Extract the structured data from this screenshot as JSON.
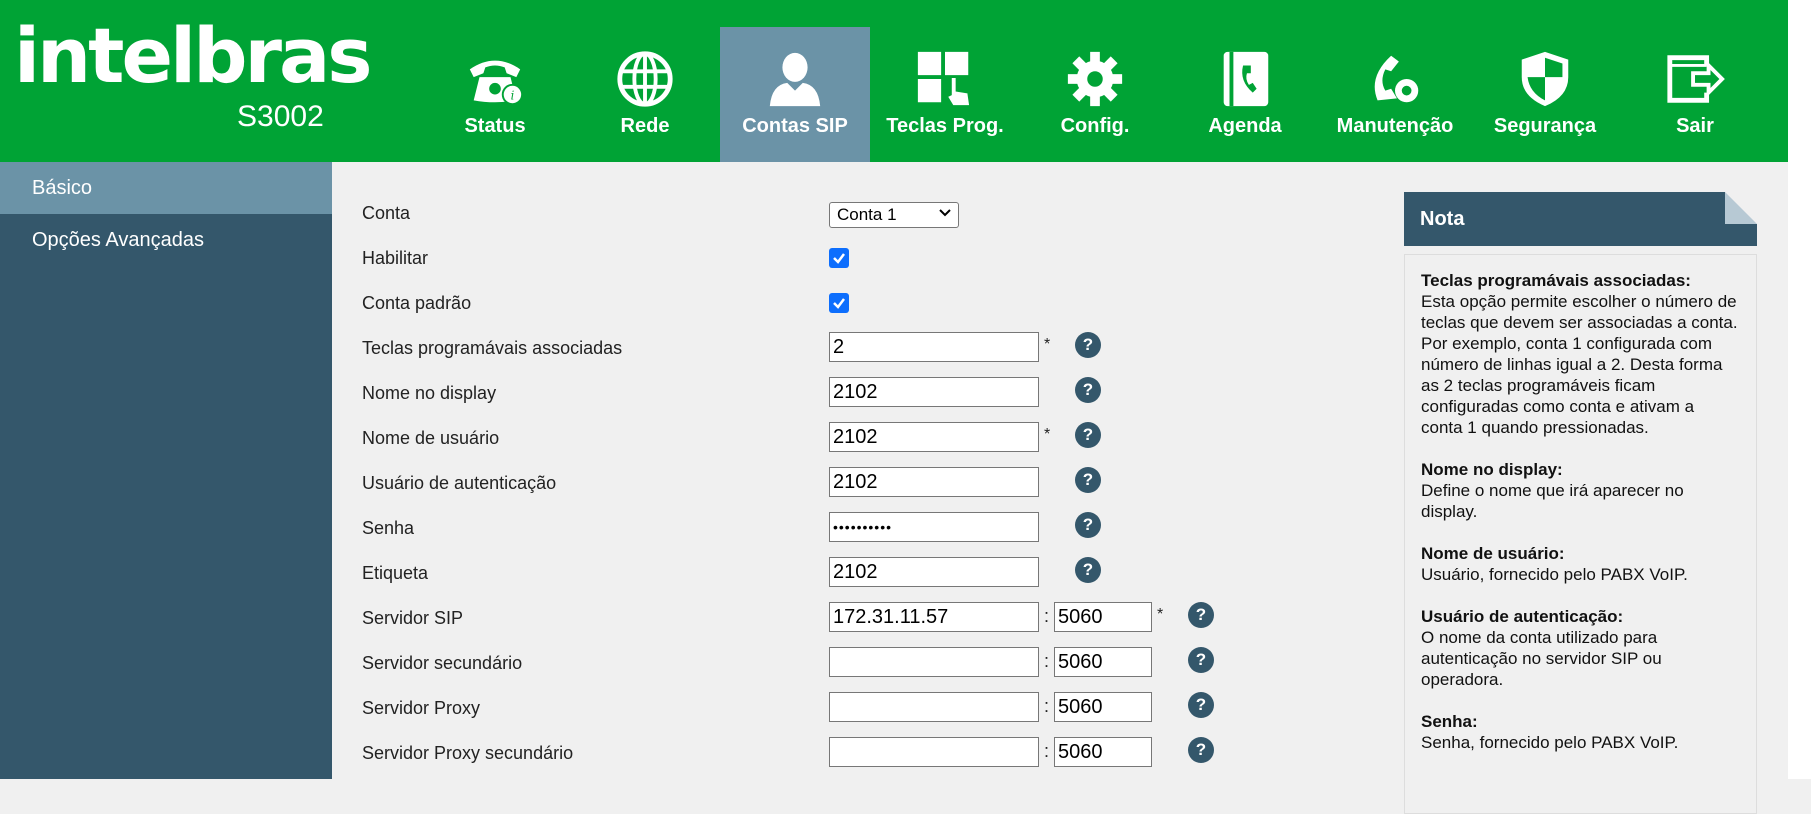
{
  "brand": {
    "logo": "intelbras",
    "model": "S3002"
  },
  "nav": [
    {
      "label": "Status",
      "icon": "phone-icon",
      "active": false
    },
    {
      "label": "Rede",
      "icon": "globe-icon",
      "active": false
    },
    {
      "label": "Contas SIP",
      "icon": "user-icon",
      "active": true
    },
    {
      "label": "Teclas Prog.",
      "icon": "keypad-icon",
      "active": false
    },
    {
      "label": "Config.",
      "icon": "gear-icon",
      "active": false
    },
    {
      "label": "Agenda",
      "icon": "phonebook-icon",
      "active": false
    },
    {
      "label": "Manutenção",
      "icon": "maintenance-icon",
      "active": false
    },
    {
      "label": "Segurança",
      "icon": "shield-icon",
      "active": false
    },
    {
      "label": "Sair",
      "icon": "logout-icon",
      "active": false
    }
  ],
  "sidebar": [
    {
      "label": "Básico",
      "active": true
    },
    {
      "label": "Opções Avançadas",
      "active": false
    }
  ],
  "form": {
    "conta": {
      "label": "Conta",
      "value": "Conta 1"
    },
    "habilitar": {
      "label": "Habilitar",
      "checked": true
    },
    "conta_padrao": {
      "label": "Conta padrão",
      "checked": true
    },
    "teclas": {
      "label": "Teclas programávais associadas",
      "value": "2",
      "required": "*"
    },
    "nome_display": {
      "label": "Nome no display",
      "value": "2102"
    },
    "nome_usuario": {
      "label": "Nome de usuário",
      "value": "2102",
      "required": "*"
    },
    "usuario_auth": {
      "label": "Usuário de autenticação",
      "value": "2102"
    },
    "senha": {
      "label": "Senha",
      "value": "••••••••••"
    },
    "etiqueta": {
      "label": "Etiqueta",
      "value": "2102"
    },
    "servidor_sip": {
      "label": "Servidor SIP",
      "value": "172.31.11.57",
      "port": "5060",
      "required": "*"
    },
    "servidor_secundario": {
      "label": "Servidor secundário",
      "value": "",
      "port": "5060"
    },
    "servidor_proxy": {
      "label": "Servidor Proxy",
      "value": "",
      "port": "5060"
    },
    "servidor_proxy_sec": {
      "label": "Servidor Proxy secundário",
      "value": "",
      "port": "5060"
    },
    "colon": ":",
    "help_glyph": "?"
  },
  "note": {
    "title": "Nota",
    "items": [
      {
        "title": "Teclas programávais associadas:",
        "text": "Esta opção permite escolher o número de teclas que devem ser associadas a conta. Por exemplo, conta 1 configurada com número de linhas igual a 2. Desta forma as 2 teclas programáveis ficam configuradas como conta e ativam a conta 1 quando pressionadas."
      },
      {
        "title": "Nome no display:",
        "text": "Define o nome que irá aparecer no display."
      },
      {
        "title": "Nome de usuário:",
        "text": "Usuário, fornecido pelo PABX VoIP."
      },
      {
        "title": "Usuário de autenticação:",
        "text": "O nome da conta utilizado para autenticação no servidor SIP ou operadora."
      },
      {
        "title": "Senha:",
        "text": "Senha, fornecido pelo PABX VoIP."
      }
    ]
  },
  "colors": {
    "green": "#00a335",
    "navy": "#34576b",
    "active": "#6b93a7",
    "checkbox": "#0d6efd"
  }
}
